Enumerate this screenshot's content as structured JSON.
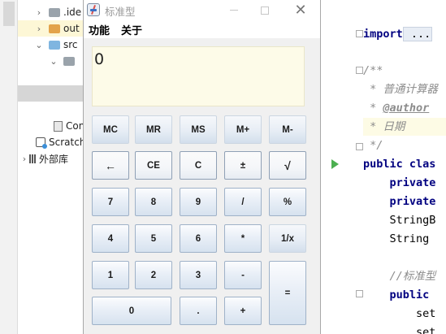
{
  "tree": {
    "row_idea": ".ide",
    "row_out": "out",
    "row_src": "src",
    "row_com": "Con",
    "row_scratch": "Scratch",
    "row_lib": "外部库"
  },
  "editor": {
    "line_import_kw": "import",
    "line_import_rest": " ...",
    "doc_open": "/**",
    "doc_line1": " * 普通计算器",
    "doc_star": " * ",
    "doc_author_tag": "@author",
    "doc_line3": " * 日期",
    "doc_close": " */",
    "class_kw": "public",
    "class_rest": " clas",
    "field1": "    private",
    "field2": "    private",
    "field3": "    StringB",
    "field4": "    String ",
    "comment_std": "    //标准型",
    "method_kw": "    public ",
    "set1": "        set",
    "set2": "        set"
  },
  "window": {
    "title": "标准型",
    "min_label": "",
    "close_label": "✕"
  },
  "menu": [
    "功能",
    "关于"
  ],
  "display": {
    "value": "0"
  },
  "keys": {
    "mc": "MC",
    "mr": "MR",
    "ms": "MS",
    "mplus": "M+",
    "mminus": "M-",
    "backspace": "←",
    "ce": "CE",
    "c": "C",
    "plusminus": "±",
    "sqrt": "√",
    "k7": "7",
    "k8": "8",
    "k9": "9",
    "div": "/",
    "pct": "%",
    "k4": "4",
    "k5": "5",
    "k6": "6",
    "mul": "*",
    "recip": "1/x",
    "k1": "1",
    "k2": "2",
    "k3": "3",
    "sub": "-",
    "eq": "=",
    "k0": "0",
    "dot": ".",
    "add": "+"
  },
  "colors": {
    "display_bg": "#fdfbe8",
    "key_border": "#9fb2c8",
    "keyword": "#000080",
    "comment": "#8c8c8c"
  }
}
